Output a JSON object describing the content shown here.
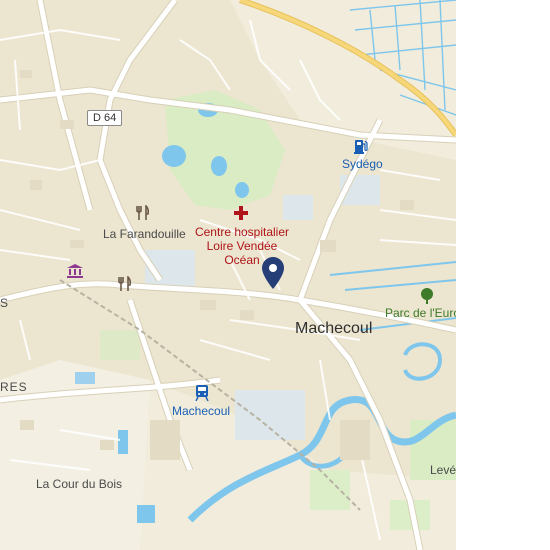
{
  "map": {
    "road_shield": "D 64",
    "places": {
      "la_farandouille": "La Farandouille",
      "hospital_line1": "Centre hospitalier",
      "hospital_line2": "Loire Vendée",
      "hospital_line3": "Océan",
      "sydego": "Sydégo",
      "machecoul_town": "Machecoul",
      "machecoul_station": "Machecoul",
      "parc": "Parc de l'Euro",
      "la_cour_du_bois": "La Cour du Bois",
      "leve": "Levé",
      "edge_s": "S",
      "edge_res": "RES"
    },
    "icons": {
      "restaurant": "fork-knife-icon",
      "museum": "museum-icon",
      "hospital": "red-cross-icon",
      "fuel": "fuel-pump-icon",
      "train": "train-station-icon",
      "park": "tree-icon",
      "marker": "location-pin-icon"
    },
    "colors": {
      "land": "#f1ecdc",
      "urban": "#e9e2cc",
      "park": "#d9ecc4",
      "water": "#7ec6ec",
      "road": "#ffffff",
      "highway": "#f6d77a",
      "hospital_red": "#b0141a",
      "transit_blue": "#1a5fb4",
      "marker": "#263e78"
    }
  }
}
